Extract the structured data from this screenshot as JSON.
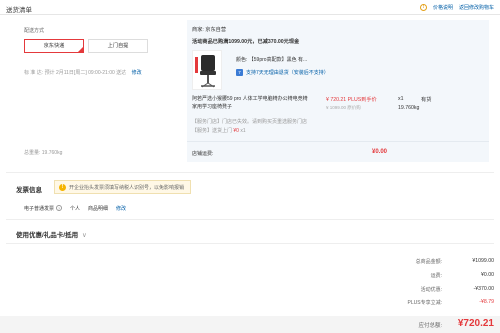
{
  "header": {
    "title": "送货清单",
    "price_note": "价格说明",
    "back_link": "返回修改购物车"
  },
  "shipping": {
    "label": "配送方式",
    "options": [
      "京东快递",
      "上门自提"
    ],
    "time_label": "标 准 达:",
    "time_value": "预计 2月11日[周二] 09:00-21:00 送达",
    "edit": "修改",
    "weight": "总重量: 19.760kg"
  },
  "store": {
    "name": "商家: 京东自营",
    "promo": "活动商品已购满1099.00元，已减370.00元现金",
    "color": "颜色: 【59pro高配款】黑色 有...",
    "returns": "支持7天无理由退货（安装后不支持）",
    "product_name": "阿若严选小猴腰59 pro 人体工学电脑椅办公椅电竞椅家用学习座椅凳子",
    "price": "¥ 720.21 PLUS到手价",
    "price_sub": "¥ 1099.00 原价购",
    "qty": "x1",
    "stock": "有货",
    "weight": "19.760kg",
    "service1": "【服务门店】门店已失效。请到购买页重选服务门店",
    "service2_prefix": "【服务】送货上门 ",
    "service2_price": "¥0",
    "service2_qty": " x1",
    "fee_label": "店铺运费:",
    "fee_value": "¥0.00"
  },
  "invoice": {
    "title": "发票信息",
    "tip": "开企业抬头发票须填写纳税人识别号，以免影响报销",
    "type": "电子普通发票",
    "q": "?",
    "person": "个人",
    "detail": "商品明细",
    "edit": "修改"
  },
  "coupon": {
    "title": "使用优惠/礼品卡/抵用",
    "chevron": "∨"
  },
  "summary": {
    "rows": [
      {
        "label": "总商品金额:",
        "value": "¥1099.00"
      },
      {
        "label": "运费:",
        "value": "¥0.00"
      },
      {
        "label": "活动优惠:",
        "value": "-¥370.00"
      },
      {
        "label": "PLUS专享立减:",
        "value": "-¥8.79"
      }
    ],
    "total_label": "应付总额:",
    "total_value": "¥720.21"
  }
}
